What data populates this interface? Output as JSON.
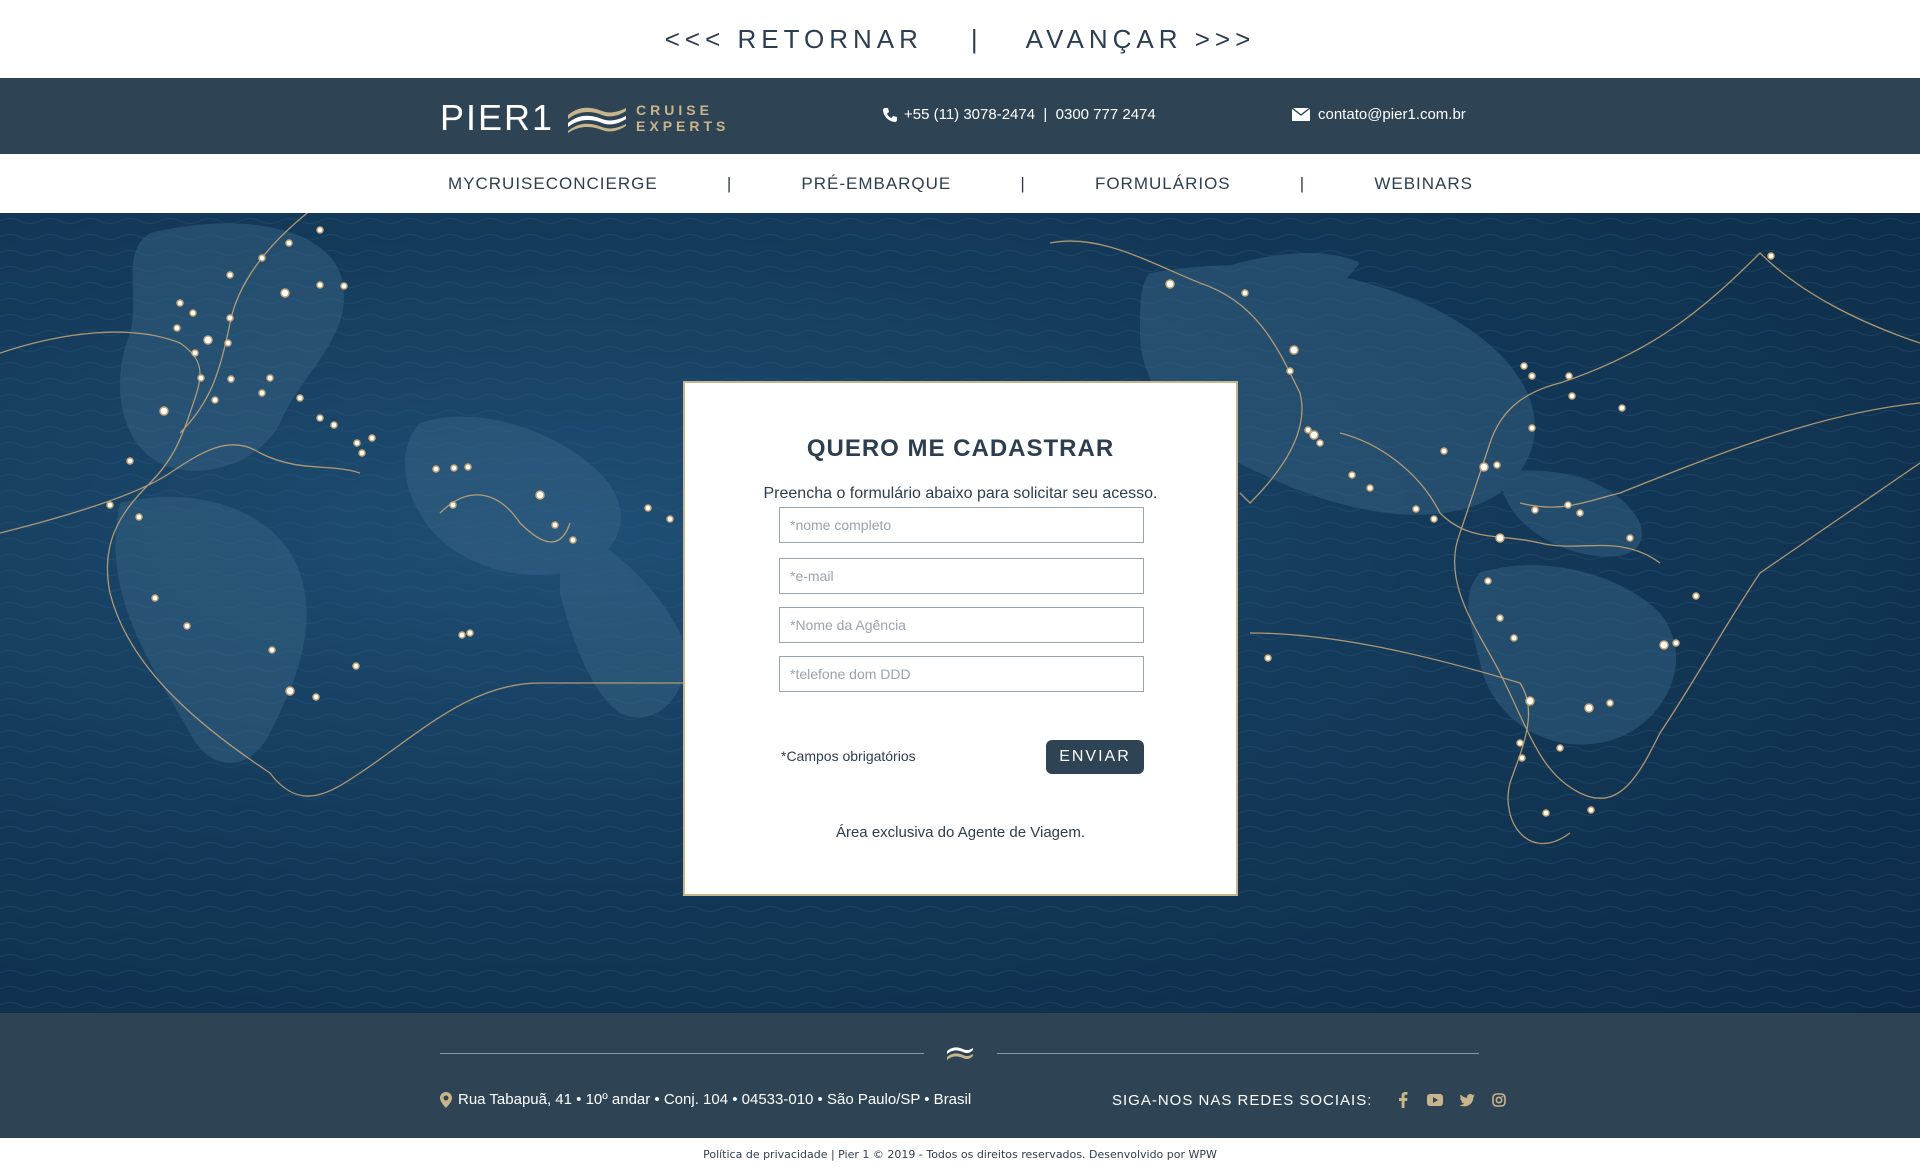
{
  "topnav": {
    "back": "<<< RETORNAR",
    "separator": "|",
    "forward": "AVANÇAR >>>"
  },
  "header": {
    "logo_text": "PIER1",
    "logo_sub_1": "CRUISE",
    "logo_sub_2": "EXPERTS",
    "phone": "+55 (11) 3078-2474  |  0300 777 2474",
    "email": "contato@pier1.com.br"
  },
  "subnav": {
    "items": [
      "MYCRUISECONCIERGE",
      "PRÉ-EMBARQUE",
      "FORMULÁRIOS",
      "WEBINARS"
    ],
    "separator": "|"
  },
  "form": {
    "title": "QUERO ME CADASTRAR",
    "subtitle": "Preencha o formulário abaixo para solicitar seu acesso.",
    "fields": [
      {
        "placeholder": "*nome completo",
        "value": ""
      },
      {
        "placeholder": "*e-mail",
        "value": ""
      },
      {
        "placeholder": "*Nome da Agência",
        "value": ""
      },
      {
        "placeholder": "*telefone dom DDD",
        "value": ""
      }
    ],
    "required_note": "*Campos obrigatórios",
    "submit_label": "ENVIAR",
    "footer_note": "Área exclusiva do Agente de Viagem."
  },
  "footer": {
    "address": "Rua Tabapuã, 41 • 10º andar • Conj. 104 • 04533-010 • São Paulo/SP • Brasil",
    "social_label": "SIGA-NOS NAS REDES SOCIAIS:",
    "social_icons": [
      "facebook-icon",
      "youtube-icon",
      "twitter-icon",
      "instagram-icon"
    ]
  },
  "copyright": "Política de privacidade | Pier 1 © 2019 - Todos os direitos reservados. Desenvolvido por WPW",
  "colors": {
    "navy": "#2e4353",
    "gold": "#c9b58c",
    "ocean": "#143a5a",
    "text": "#2c3e4f"
  }
}
